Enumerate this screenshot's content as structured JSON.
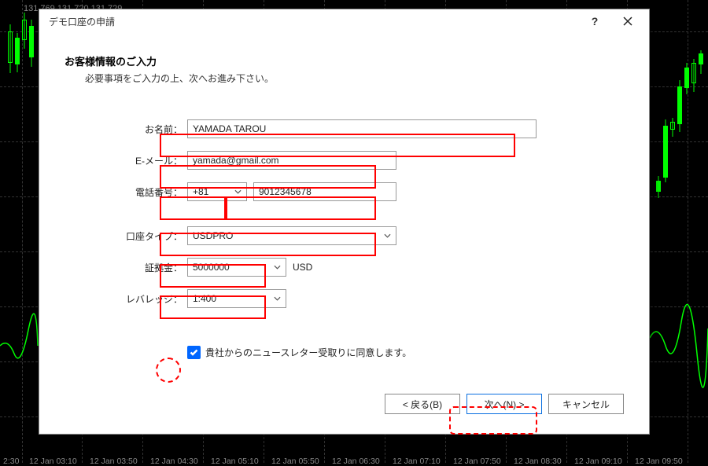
{
  "chart": {
    "ohlc": "131.769 131.720 131.729",
    "time_labels": [
      "2:30",
      "12 Jan 03:10",
      "12 Jan 03:50",
      "12 Jan 04:30",
      "12 Jan 05:10",
      "12 Jan 05:50",
      "12 Jan 06:30",
      "12 Jan 07:10",
      "12 Jan 07:50",
      "12 Jan 08:30",
      "12 Jan 09:10",
      "12 Jan 09:50"
    ]
  },
  "dialog": {
    "title": "デモ口座の申請",
    "heading": "お客様情報のご入力",
    "sub_heading": "必要事項をご入力の上、次へお進み下さい。",
    "labels": {
      "name": "お名前：",
      "email": "E-メール：",
      "phone": "電話番号：",
      "account_type": "口座タイプ：",
      "deposit": "証拠金：",
      "leverage": "レバレッジ："
    },
    "values": {
      "name": "YAMADA TAROU",
      "email": "yamada@gmail.com",
      "phone_code": "+81",
      "phone_number": "9012345678",
      "account_type": "USDPRO",
      "deposit": "5000000",
      "deposit_currency": "USD",
      "leverage": "1:400"
    },
    "consent_label": "貴社からのニュースレター受取りに同意します。",
    "consent_checked": true,
    "buttons": {
      "back": "< 戻る(B)",
      "next": "次へ(N) >",
      "cancel": "キャンセル"
    }
  }
}
